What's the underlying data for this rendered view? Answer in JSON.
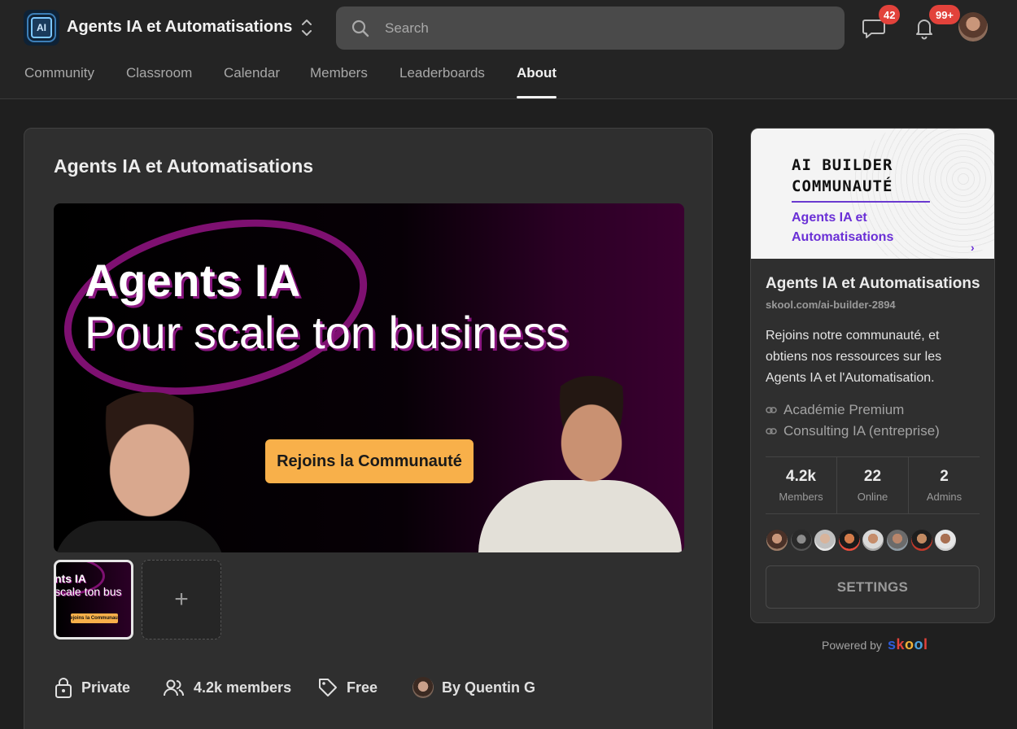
{
  "header": {
    "group_name": "Agents IA et Automatisations",
    "logo_text": "AI",
    "search": {
      "placeholder": "Search"
    },
    "chat_badge": "42",
    "notifications_badge": "99+"
  },
  "nav": {
    "tabs": [
      {
        "label": "Community",
        "active": false
      },
      {
        "label": "Classroom",
        "active": false
      },
      {
        "label": "Calendar",
        "active": false
      },
      {
        "label": "Members",
        "active": false
      },
      {
        "label": "Leaderboards",
        "active": false
      },
      {
        "label": "About",
        "active": true
      }
    ]
  },
  "main": {
    "title": "Agents IA et Automatisations",
    "hero": {
      "line1": "Agents IA",
      "line2": "Pour scale ton business",
      "cta": "Rejoins la Communauté"
    },
    "thumbnail": {
      "line1": "nts IA",
      "line2": "scale ton bus",
      "cta": "Rejoins la Communauté"
    },
    "add_media_label": "+",
    "meta": {
      "privacy": "Private",
      "members": "4.2k members",
      "price": "Free",
      "owner": "By Quentin G"
    }
  },
  "sidebar": {
    "banner": {
      "line1": "AI BUILDER",
      "line2": "COMMUNAUTÉ",
      "subtitle": "Agents IA et Automatisations",
      "chevron": "›"
    },
    "title": "Agents IA et Automatisations",
    "url": "skool.com/ai-builder-2894",
    "description": "Rejoins notre communauté, et obtiens nos ressources sur les Agents IA et l'Automatisation.",
    "links": [
      "Académie Premium",
      "Consulting IA (entreprise)"
    ],
    "stats": [
      {
        "value": "4.2k",
        "label": "Members"
      },
      {
        "value": "22",
        "label": "Online"
      },
      {
        "value": "2",
        "label": "Admins"
      }
    ],
    "settings_label": "SETTINGS"
  },
  "footer": {
    "powered_by": "Powered by",
    "brand": [
      "s",
      "k",
      "o",
      "o",
      "l"
    ]
  },
  "colors": {
    "background": "#1f1f1f",
    "card": "#2f2f2f",
    "badge": "#e2423b",
    "cta": "#f8b04a",
    "accent_purple": "#6a2fd6",
    "hero_magenta": "#7e1071"
  }
}
